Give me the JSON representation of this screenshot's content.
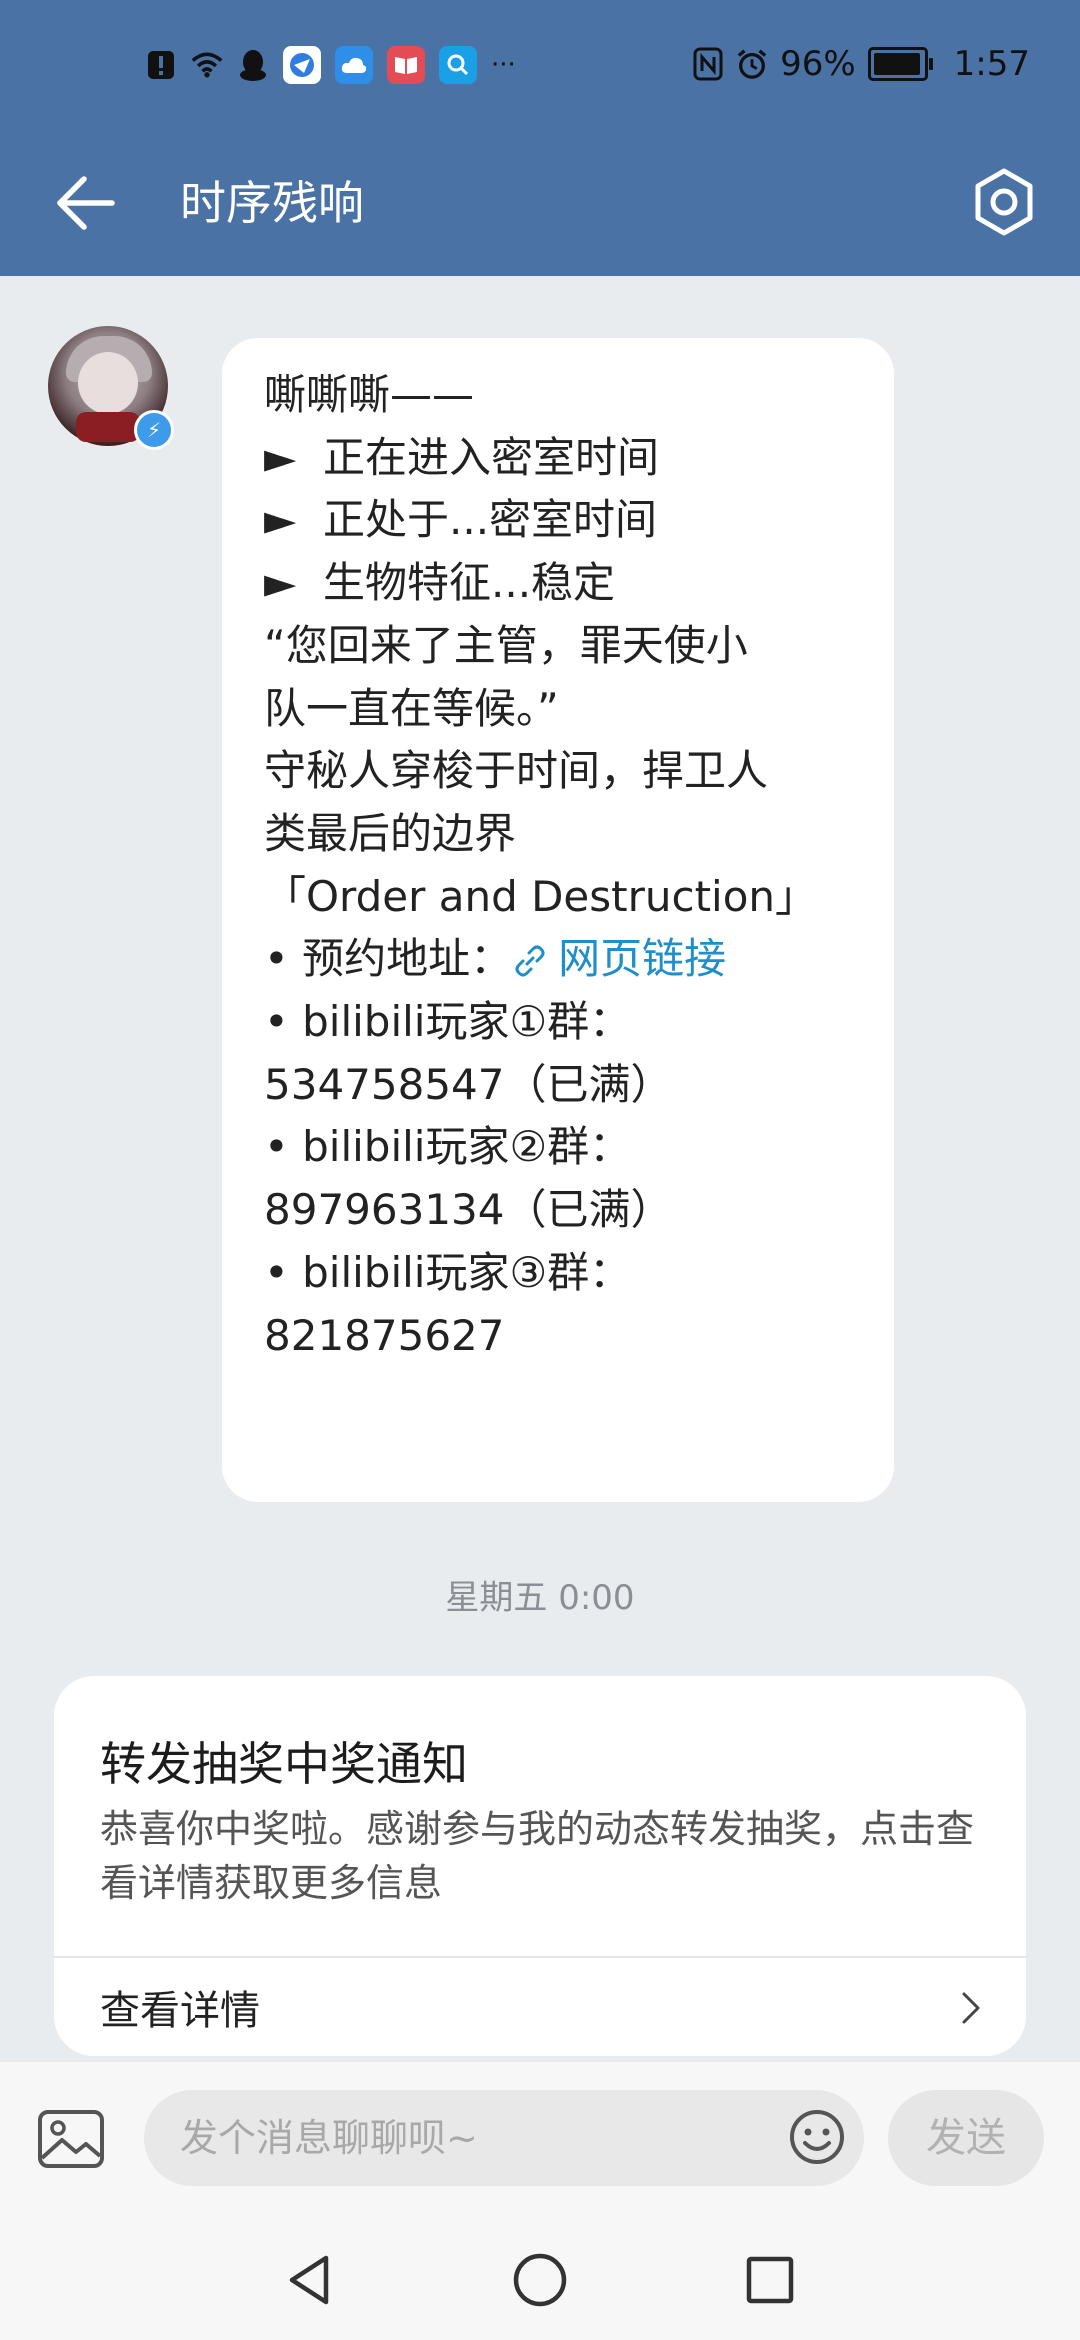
{
  "status_bar": {
    "battery_text": "96%",
    "time": "1:57",
    "more_label": "···",
    "battery_level": 0.96,
    "app_icons": [
      "alert-icon",
      "wifi-icon",
      "qq-icon",
      "browser-icon",
      "cloud-icon",
      "book-icon",
      "search-app-icon"
    ]
  },
  "header": {
    "title": "时序残响",
    "background_color": "#4a72a5"
  },
  "message": {
    "lines": [
      "嘶嘶嘶——",
      "►  正在进入密室时间",
      "►  正处于...密室时间",
      "►  生物特征...稳定",
      "“您回来了主管，罪天使小",
      "队一直在等候。”",
      "",
      "守秘人穿梭于时间，捍卫人",
      "类最后的边界",
      "「Order and Destruction」",
      "",
      "• 预约地址：",
      "• bilibili玩家①群：",
      "534758547（已满）",
      "• bilibili玩家②群：",
      "897963134（已满）",
      "• bilibili玩家③群：",
      "821875627"
    ],
    "link_label": "网页链接",
    "link_color": "#1f8ec9"
  },
  "timestamp": "星期五 0:00",
  "notification": {
    "title": "转发抽奖中奖通知",
    "body": "恭喜你中奖啦。感谢参与我的动态转发抽奖，点击查看详情获取更多信息",
    "detail_label": "查看详情"
  },
  "input_bar": {
    "placeholder": "发个消息聊聊呗~",
    "send_label": "发送"
  }
}
